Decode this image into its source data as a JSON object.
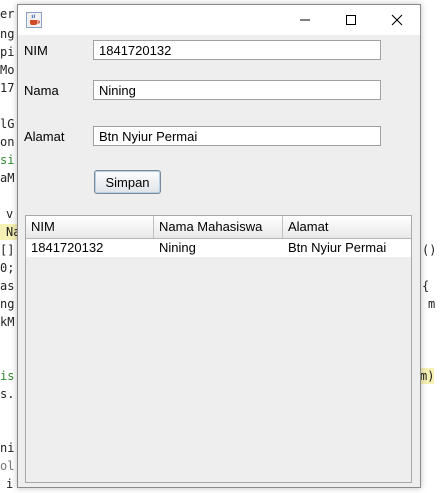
{
  "editor": {
    "lines": [
      "er",
      "ng",
      "pi",
      "Mo",
      "17",
      "",
      "lG",
      "on",
      "si",
      "aM",
      "",
      "v",
      "Na",
      "[]",
      "0;",
      "as",
      "ng",
      "kM",
      "",
      "",
      "is",
      "s.",
      "",
      "",
      "ni",
      "ol",
      "i"
    ],
    "right_fragments": [
      "()",
      "{",
      "m",
      "m)"
    ]
  },
  "window": {
    "icon": "java-cup-icon",
    "controls": [
      "minimize-icon",
      "maximize-icon",
      "close-icon"
    ]
  },
  "form": {
    "nim_label": "NIM",
    "nim_value": "1841720132",
    "nama_label": "Nama",
    "nama_value": "Nining",
    "alamat_label": "Alamat",
    "alamat_value": "Btn Nyiur Permai",
    "submit_label": "Simpan"
  },
  "table": {
    "columns": [
      "NIM",
      "Nama Mahasiswa",
      "Alamat"
    ],
    "rows": [
      [
        "1841720132",
        "Nining",
        "Btn Nyiur Permai"
      ]
    ]
  }
}
